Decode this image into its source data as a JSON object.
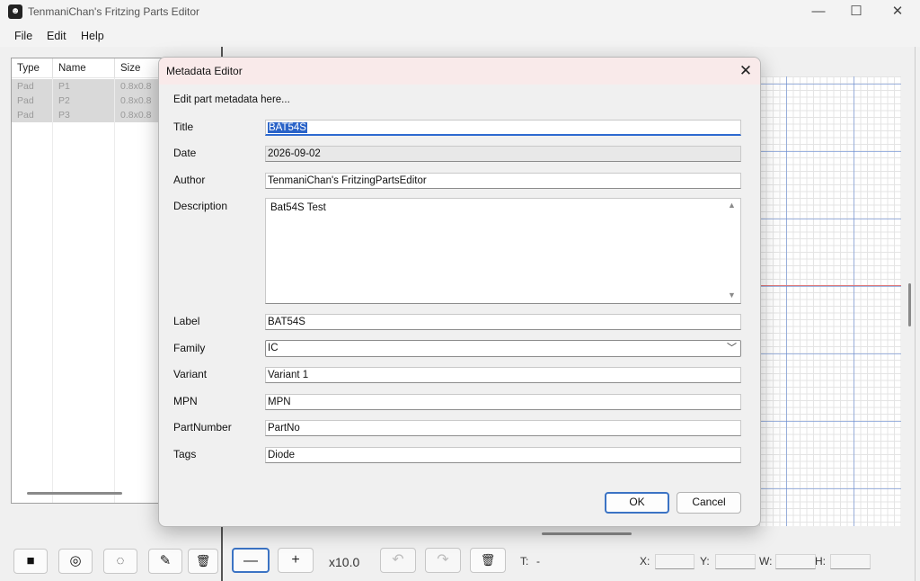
{
  "window": {
    "title": "TenmaniChan's Fritzing Parts Editor",
    "controls": {
      "minimize": "—",
      "maximize": "☐",
      "close": "✕"
    }
  },
  "menu": {
    "items": [
      "File",
      "Edit",
      "Help"
    ]
  },
  "parts_table": {
    "columns": [
      "Type",
      "Name",
      "Size"
    ],
    "rows": [
      {
        "type": "Pad",
        "name": "P1",
        "size": "0.8x0.8"
      },
      {
        "type": "Pad",
        "name": "P2",
        "size": "0.8x0.8"
      },
      {
        "type": "Pad",
        "name": "P3",
        "size": "0.8x0.8"
      }
    ]
  },
  "left_toolbar": {
    "icons": [
      "square-pad-icon",
      "circle-pad-icon",
      "dashed-circle-icon",
      "pencil-icon",
      "trash-icon"
    ],
    "glyphs": [
      "■",
      "◎",
      "◌",
      "✎",
      "🗑"
    ]
  },
  "bottom_toolbar": {
    "zoom_out": "—",
    "zoom_in": "+",
    "zoom_level": "x10.0",
    "undo": "↶",
    "redo": "↷",
    "delete": "🗑",
    "t_label": "T:",
    "t_value": "-",
    "x_label": "X:",
    "y_label": "Y:",
    "w_label": "W:",
    "h_label": "H:"
  },
  "dialog": {
    "title": "Metadata Editor",
    "close": "✕",
    "intro": "Edit part metadata here...",
    "fields": {
      "title": {
        "label": "Title",
        "value": "BAT54S"
      },
      "date": {
        "label": "Date",
        "value": "2026-09-02"
      },
      "author": {
        "label": "Author",
        "value": "TenmaniChan's FritzingPartsEditor"
      },
      "description": {
        "label": "Description",
        "value": "Bat54S Test"
      },
      "label": {
        "label": "Label",
        "value": "BAT54S"
      },
      "family": {
        "label": "Family",
        "value": "IC"
      },
      "variant": {
        "label": "Variant",
        "value": "Variant 1"
      },
      "mpn": {
        "label": "MPN",
        "value": "MPN"
      },
      "partnumber": {
        "label": "PartNumber",
        "value": "PartNo"
      },
      "tags": {
        "label": "Tags",
        "value": "Diode"
      }
    },
    "ok": "OK",
    "cancel": "Cancel"
  },
  "colors": {
    "accent": "#3b73c4",
    "selection": "#2a63c8",
    "grid_major": "#5a82d2",
    "grid_axis": "#e07a7a",
    "dialog_title_bg": "#f9eaea"
  }
}
